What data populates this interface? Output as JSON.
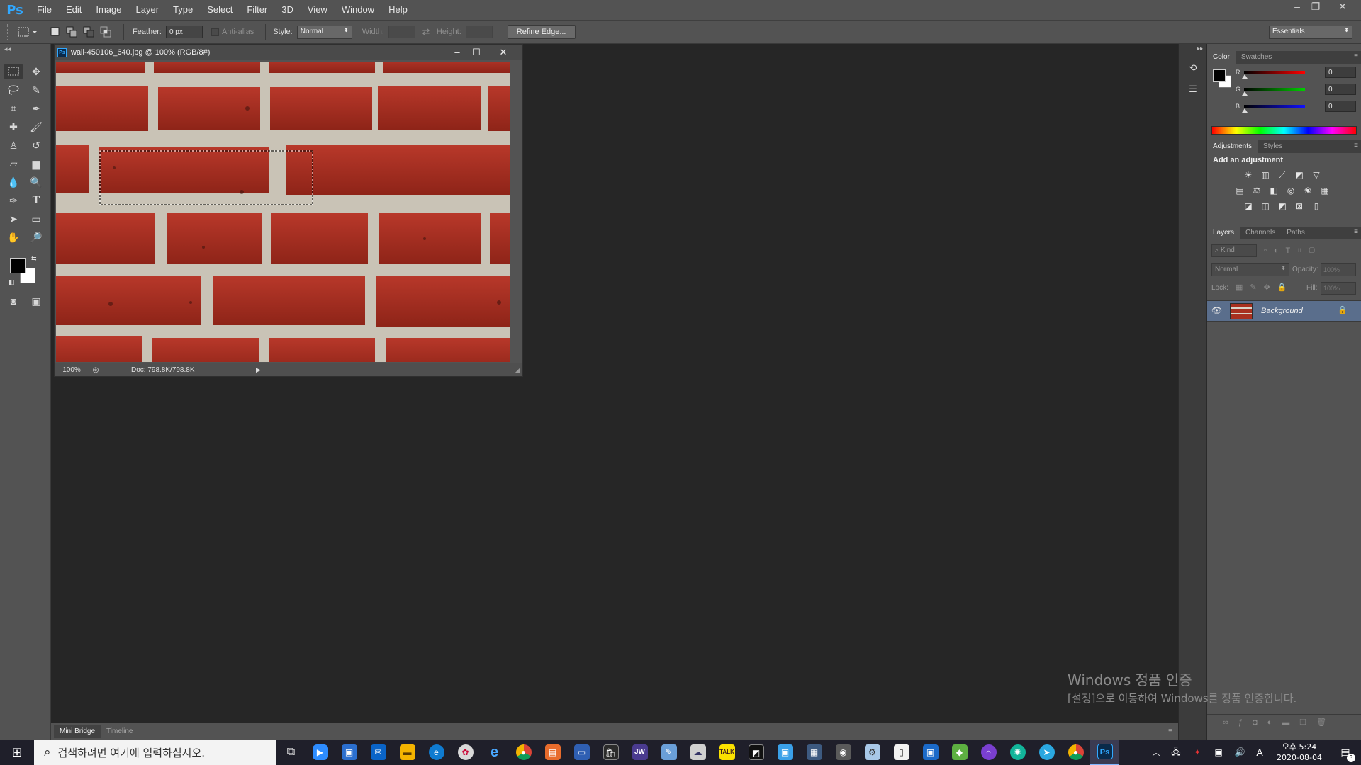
{
  "app": {
    "logo": "Ps",
    "menu": [
      "File",
      "Edit",
      "Image",
      "Layer",
      "Type",
      "Select",
      "Filter",
      "3D",
      "View",
      "Window",
      "Help"
    ],
    "window_controls": [
      "–",
      "❐",
      "✕"
    ]
  },
  "options_bar": {
    "feather_label": "Feather:",
    "feather_value": "0 px",
    "antialias_label": "Anti-alias",
    "style_label": "Style:",
    "style_value": "Normal",
    "width_label": "Width:",
    "height_label": "Height:",
    "refine_edge_label": "Refine Edge...",
    "workspace_value": "Essentials"
  },
  "document": {
    "title": "wall-450106_640.jpg @ 100% (RGB/8#)",
    "zoom": "100%",
    "doc_size": "Doc: 798.8K/798.8K"
  },
  "color_panel": {
    "tabs": [
      "Color",
      "Swatches"
    ],
    "r_label": "R",
    "r_value": "0",
    "g_label": "G",
    "g_value": "0",
    "b_label": "B",
    "b_value": "0",
    "foreground_color": "#000000",
    "background_color": "#ffffff"
  },
  "adjustments_panel": {
    "tabs": [
      "Adjustments",
      "Styles"
    ],
    "heading": "Add an adjustment"
  },
  "layers_panel": {
    "tabs": [
      "Layers",
      "Channels",
      "Paths"
    ],
    "filter_kind": "Kind",
    "blend_mode": "Normal",
    "opacity_label": "Opacity:",
    "opacity_value": "100%",
    "lock_label": "Lock:",
    "fill_label": "Fill:",
    "fill_value": "100%",
    "layers": [
      {
        "name": "Background",
        "visible": true,
        "locked": true
      }
    ]
  },
  "bottom_tabs": [
    "Mini Bridge",
    "Timeline"
  ],
  "watermark": {
    "line1": "Windows 정품 인증",
    "line2": "[설정]으로 이동하여 Windows를 정품 인증합니다."
  },
  "taskbar": {
    "search_placeholder": "검색하려면 여기에 입력하십시오.",
    "clock_time": "오후 5:24",
    "clock_date": "2020-08-04",
    "notification_count": "3",
    "ime_label": "A"
  },
  "colors": {
    "ui_panel": "#535353",
    "workspace": "#262626",
    "ps_blue": "#31a8ff",
    "brick_red": "#a8301f",
    "mortar": "#d9d4c8"
  }
}
